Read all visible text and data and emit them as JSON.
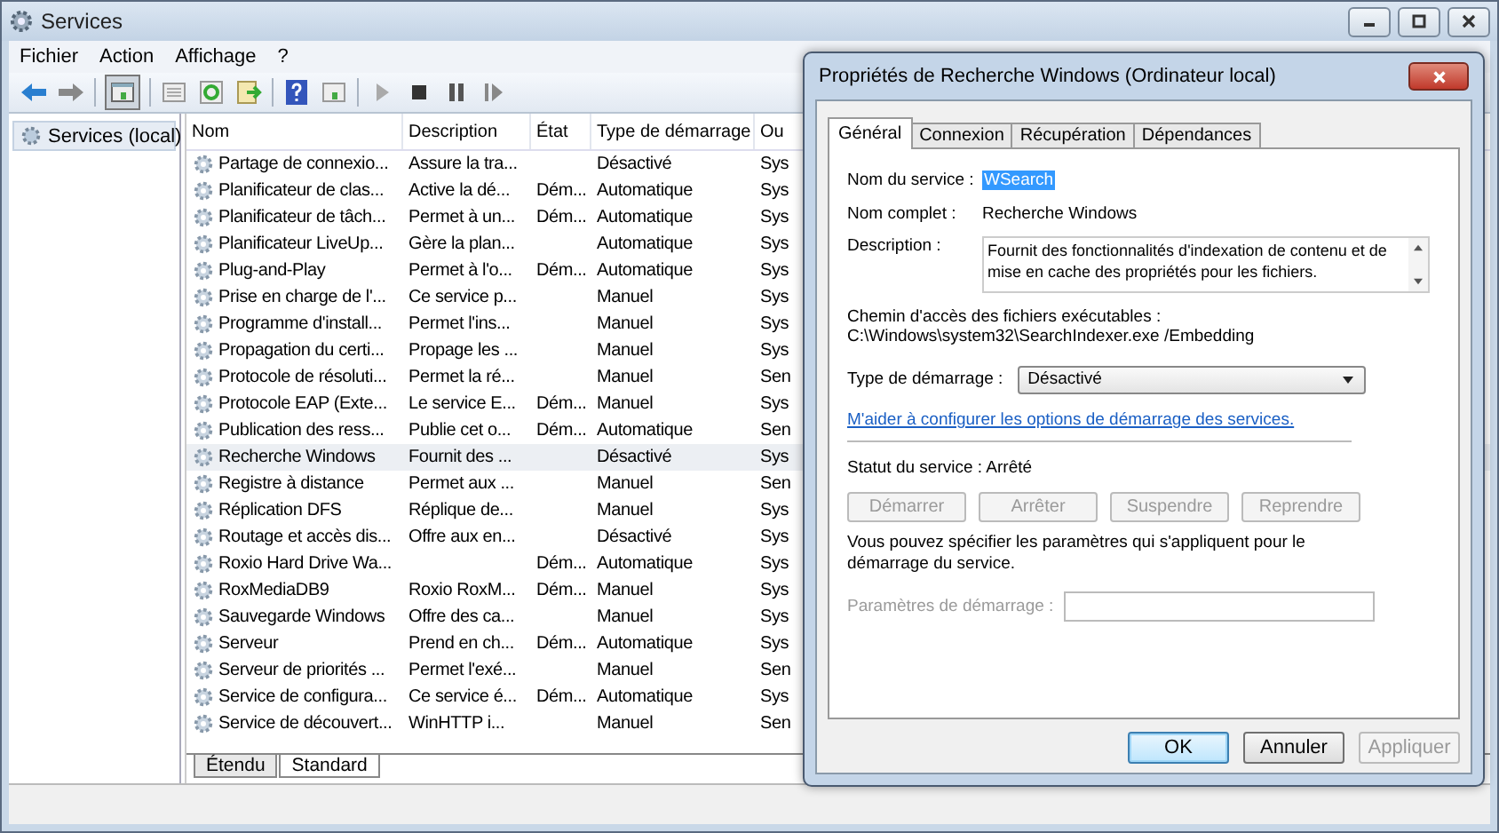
{
  "window": {
    "title": "Services"
  },
  "menu": [
    "Fichier",
    "Action",
    "Affichage",
    "?"
  ],
  "tree": {
    "label": "Services (local)",
    "selected": true
  },
  "table": {
    "columns": [
      "Nom",
      "Description",
      "État",
      "Type de démarrage",
      "Ou"
    ],
    "rows": [
      {
        "cells": [
          "Partage de connexio...",
          "Assure la tra...",
          "",
          "Désactivé",
          "Sys"
        ],
        "selected": false
      },
      {
        "cells": [
          "Planificateur de clas...",
          "Active la dé...",
          "Dém...",
          "Automatique",
          "Sys"
        ],
        "selected": false
      },
      {
        "cells": [
          "Planificateur de tâch...",
          "Permet à un...",
          "Dém...",
          "Automatique",
          "Sys"
        ],
        "selected": false
      },
      {
        "cells": [
          "Planificateur LiveUp...",
          "Gère la plan...",
          "",
          "Automatique",
          "Sys"
        ],
        "selected": false
      },
      {
        "cells": [
          "Plug-and-Play",
          "Permet à l'o...",
          "Dém...",
          "Automatique",
          "Sys"
        ],
        "selected": false
      },
      {
        "cells": [
          "Prise en charge de l'...",
          "Ce service p...",
          "",
          "Manuel",
          "Sys"
        ],
        "selected": false
      },
      {
        "cells": [
          "Programme d'install...",
          "Permet l'ins...",
          "",
          "Manuel",
          "Sys"
        ],
        "selected": false
      },
      {
        "cells": [
          "Propagation du certi...",
          "Propage les ...",
          "",
          "Manuel",
          "Sys"
        ],
        "selected": false
      },
      {
        "cells": [
          "Protocole de résoluti...",
          "Permet la ré...",
          "",
          "Manuel",
          "Sen"
        ],
        "selected": false
      },
      {
        "cells": [
          "Protocole EAP (Exte...",
          "Le service E...",
          "Dém...",
          "Manuel",
          "Sys"
        ],
        "selected": false
      },
      {
        "cells": [
          "Publication des ress...",
          "Publie cet o...",
          "Dém...",
          "Automatique",
          "Sen"
        ],
        "selected": false
      },
      {
        "cells": [
          "Recherche Windows",
          "Fournit des ...",
          "",
          "Désactivé",
          "Sys"
        ],
        "selected": true
      },
      {
        "cells": [
          "Registre à distance",
          "Permet aux ...",
          "",
          "Manuel",
          "Sen"
        ],
        "selected": false
      },
      {
        "cells": [
          "Réplication DFS",
          "Réplique de...",
          "",
          "Manuel",
          "Sys"
        ],
        "selected": false
      },
      {
        "cells": [
          "Routage et accès dis...",
          "Offre aux en...",
          "",
          "Désactivé",
          "Sys"
        ],
        "selected": false
      },
      {
        "cells": [
          "Roxio Hard Drive Wa...",
          "",
          "Dém...",
          "Automatique",
          "Sys"
        ],
        "selected": false
      },
      {
        "cells": [
          "RoxMediaDB9",
          "Roxio RoxM...",
          "Dém...",
          "Manuel",
          "Sys"
        ],
        "selected": false
      },
      {
        "cells": [
          "Sauvegarde Windows",
          "Offre des ca...",
          "",
          "Manuel",
          "Sys"
        ],
        "selected": false
      },
      {
        "cells": [
          "Serveur",
          "Prend en ch...",
          "Dém...",
          "Automatique",
          "Sys"
        ],
        "selected": false
      },
      {
        "cells": [
          "Serveur de priorités ...",
          "Permet l'exé...",
          "",
          "Manuel",
          "Sen"
        ],
        "selected": false
      },
      {
        "cells": [
          "Service de configura...",
          "Ce service é...",
          "Dém...",
          "Automatique",
          "Sys"
        ],
        "selected": false
      },
      {
        "cells": [
          "Service de découvert...",
          "WinHTTP i...",
          "",
          "Manuel",
          "Sen"
        ],
        "selected": false
      }
    ]
  },
  "view_tabs": [
    {
      "label": "Étendu",
      "selected": false
    },
    {
      "label": "Standard",
      "selected": true
    }
  ],
  "dialog": {
    "title": "Propriétés de Recherche Windows (Ordinateur local)",
    "tabs": [
      {
        "label": "Général",
        "selected": true
      },
      {
        "label": "Connexion",
        "selected": false
      },
      {
        "label": "Récupération",
        "selected": false
      },
      {
        "label": "Dépendances",
        "selected": false
      }
    ],
    "service_name_label": "Nom du service :",
    "service_name": "WSearch",
    "full_name_label": "Nom complet :",
    "full_name": "Recherche Windows",
    "description_label": "Description :",
    "description": "Fournit des fonctionnalités d'indexation de contenu et de mise en cache des propriétés pour les fichiers.",
    "path_label": "Chemin d'accès des fichiers exécutables :",
    "path": "C:\\Windows\\system32\\SearchIndexer.exe /Embedding",
    "startup_label": "Type de démarrage :",
    "startup_value": "Désactivé",
    "help_link": "M'aider à configurer les options de démarrage des services.",
    "status": "Statut du service : Arrêté",
    "service_buttons": [
      {
        "label": "Démarrer",
        "disabled": true
      },
      {
        "label": "Arrêter",
        "disabled": true
      },
      {
        "label": "Suspendre",
        "disabled": true
      },
      {
        "label": "Reprendre",
        "disabled": true
      }
    ],
    "params_note": "Vous pouvez spécifier les paramètres qui s'appliquent pour le démarrage du service.",
    "params_label": "Paramètres de démarrage :",
    "params_disabled": true,
    "buttons": [
      {
        "label": "OK",
        "disabled": false
      },
      {
        "label": "Annuler",
        "disabled": false
      },
      {
        "label": "Appliquer",
        "disabled": true
      }
    ]
  }
}
